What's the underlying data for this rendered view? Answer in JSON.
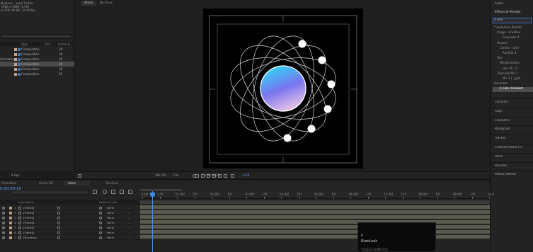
{
  "project": {
    "info_line1": "Nucleus , used 1 time",
    "info_line2": "1080 x 1080 (1.00)",
    "info_line3": "Δ 0:00:10:00, 30.00 fps",
    "columns": {
      "type": "Type",
      "size": "Size",
      "frame_rate": "Frame R..."
    },
    "rows": [
      {
        "name": "",
        "type": "Composition",
        "fr": "30",
        "selected": false
      },
      {
        "name": "",
        "type": "Composition",
        "fr": "30",
        "selected": false
      },
      {
        "name": "Animation",
        "type": "Composition",
        "fr": "30",
        "selected": false
      },
      {
        "name": "",
        "type": "Composition",
        "fr": "30",
        "selected": true
      },
      {
        "name": "",
        "type": "Composition",
        "fr": "30",
        "selected": false
      },
      {
        "name": "",
        "type": "Composition",
        "fr": "30",
        "selected": false
      }
    ],
    "footer_label": "8 bpc"
  },
  "viewer": {
    "tabs": [
      "Atom",
      "Nucleus"
    ],
    "zoom": "(49.2%)",
    "resolution": "Full",
    "exposure": "+0.0",
    "timecode": "0:00:00:10"
  },
  "right_panel": {
    "audio": "Audio",
    "effects_title": "Effects & Presets",
    "search_value": "ℓ Gra",
    "tree": [
      {
        "label": "* Animation Presets",
        "indent": 0
      },
      {
        "label": "Image - Creative",
        "indent": 1
      },
      {
        "label": "Grayscale 4",
        "indent": 3
      },
      {
        "label": "Shapes",
        "indent": 1
      },
      {
        "label": "Centric - Grid",
        "indent": 2
      },
      {
        "label": "RayStar 4",
        "indent": 3
      },
      {
        "label": "Text",
        "indent": 1
      },
      {
        "label": "Miscellaneous",
        "indent": 2
      },
      {
        "label": "Hue Sh...d",
        "indent": 3
      },
      {
        "label": "Trapcode Mir 3",
        "indent": 1
      },
      {
        "label": "Mir 3.1 _ig B",
        "indent": 3
      },
      {
        "label": "Generate",
        "indent": 0
      },
      {
        "label": "4-Color Gradient",
        "indent": 2
      }
    ],
    "panels": [
      "Libraries",
      "Align",
      "Character",
      "Paragraph",
      "Tracker",
      "Content-Aware Fill",
      "Paint",
      "Brushes",
      "Motion Sketch"
    ]
  },
  "timeline": {
    "tabs": [
      "Animation",
      "Green BG",
      "Atom",
      "Nucleus"
    ],
    "current_time": "0;00;00;10",
    "header": {
      "layer_name": "Layer Name",
      "parent": "Parent & Link"
    },
    "layers": [
      {
        "num": "1",
        "name": "[Orbit4]",
        "parent": "None"
      },
      {
        "num": "2",
        "name": "[Orbit4]",
        "parent": "None"
      },
      {
        "num": "3",
        "name": "[Orbit4]",
        "parent": "None"
      },
      {
        "num": "4",
        "name": "[Orbit4]",
        "parent": "None"
      },
      {
        "num": "5",
        "name": "[Orbit4]",
        "parent": "None"
      },
      {
        "num": "6",
        "name": "[Orbit4]",
        "parent": "None"
      },
      {
        "num": "7",
        "name": "[Nucleus]",
        "parent": "None"
      }
    ],
    "ruler": [
      "0:00f",
      "15f",
      "01:00f",
      "15f",
      "02:00f",
      "15f",
      "03:00f",
      "15f",
      "04:00f",
      "15f",
      "05:00f",
      "15f",
      "06:00f",
      "15f",
      "07:00f",
      "15f",
      "08:00f",
      "15f",
      "09:00f",
      "15f",
      "10:0"
    ]
  },
  "overlay": {
    "title": "NumLock",
    "subtitle": "TOGGLE NUMLOCK"
  },
  "colors": {
    "accent": "#3d8ee5",
    "nucleus_top": "#36c6f2",
    "nucleus_bottom": "#e8b7e7"
  }
}
